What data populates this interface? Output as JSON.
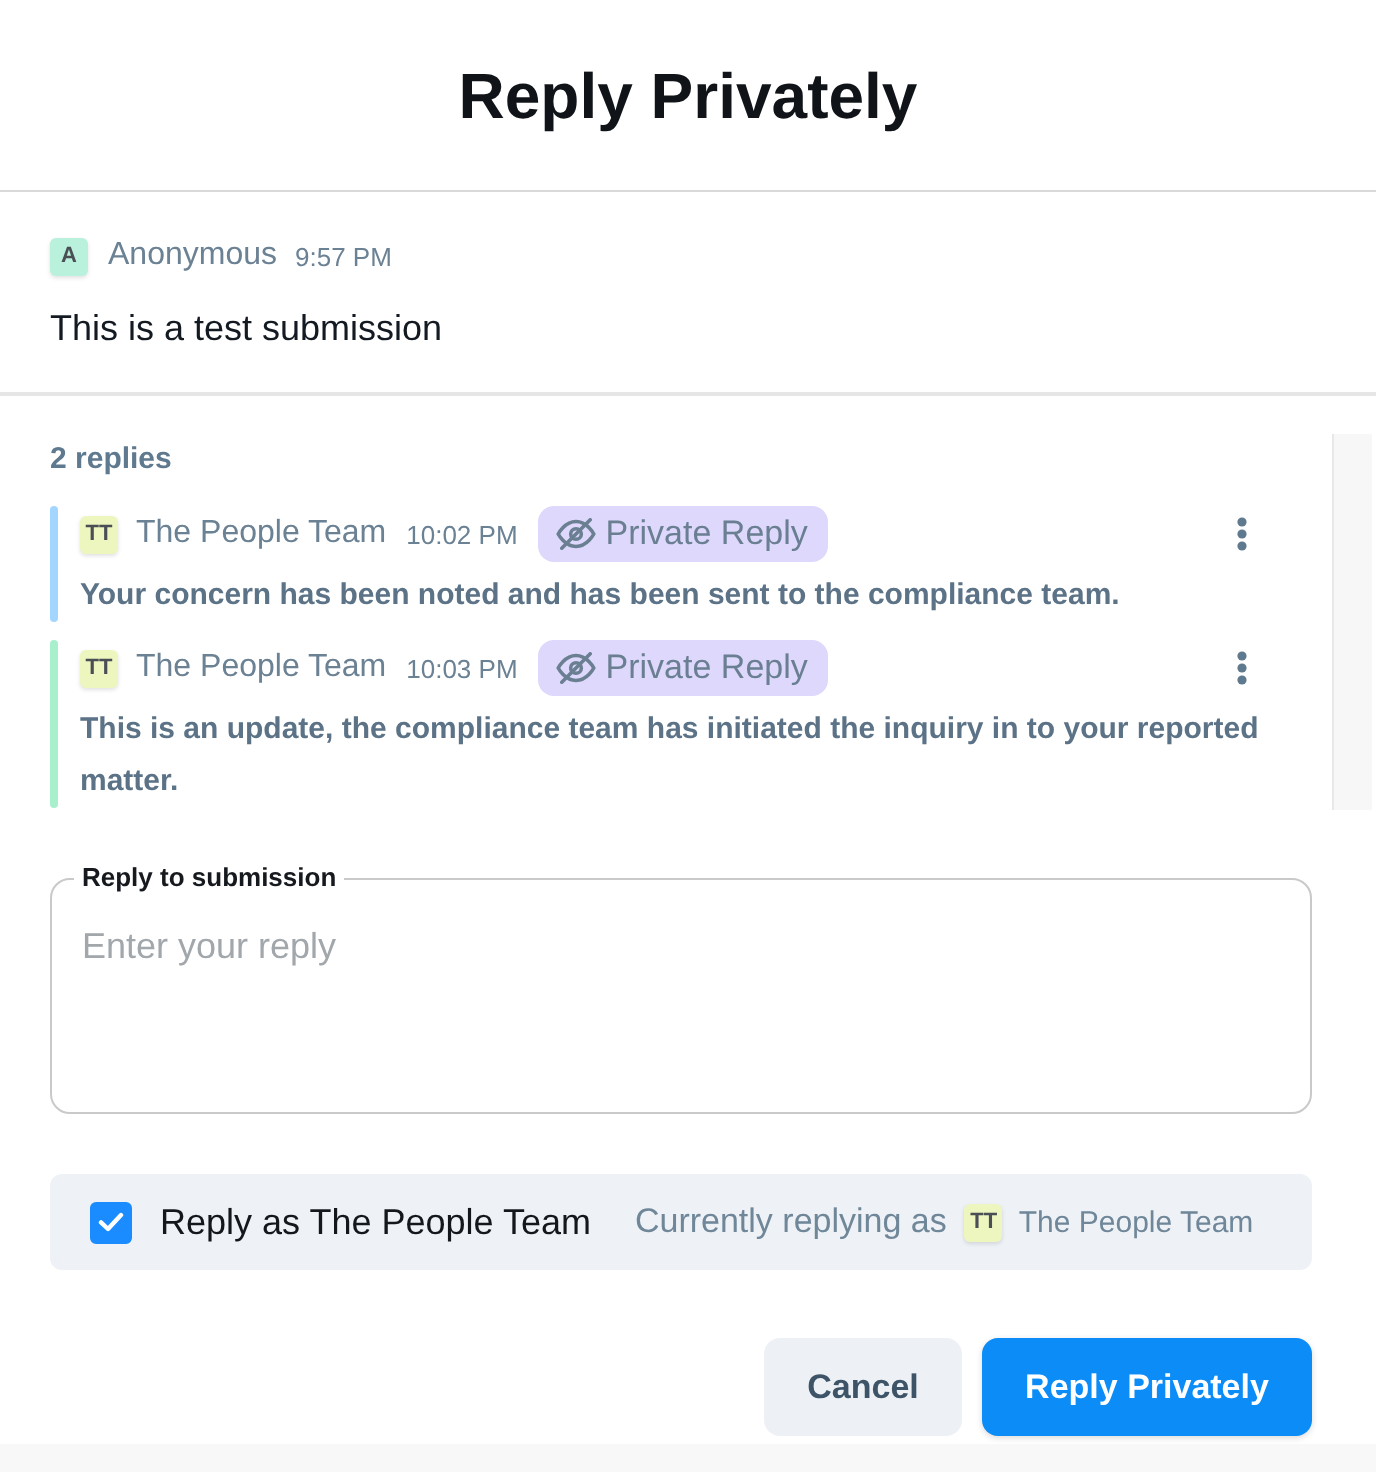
{
  "dialog": {
    "title": "Reply Privately"
  },
  "submission": {
    "avatar": "A",
    "author": "Anonymous",
    "time": "9:57 PM",
    "text": "This is a test submission"
  },
  "replies": {
    "count_label": "2 replies",
    "items": [
      {
        "avatar": "TT",
        "author": "The People Team",
        "time": "10:02 PM",
        "badge": "Private Reply",
        "text": "Your concern has been noted and has been sent to the compliance team.",
        "color": "#a3d6ff"
      },
      {
        "avatar": "TT",
        "author": "The People Team",
        "time": "10:03 PM",
        "badge": "Private Reply",
        "text": "This is an update, the compliance team has initiated the inquiry in to your reported matter.",
        "color": "#a8efcb"
      }
    ]
  },
  "reply_field": {
    "label": "Reply to submission",
    "placeholder": "Enter your reply"
  },
  "reply_as": {
    "checked": true,
    "label": "Reply as The People Team",
    "current_label": "Currently replying as",
    "current_avatar": "TT",
    "current_name": "The People Team"
  },
  "buttons": [
    {
      "label": "Cancel",
      "kind": "secondary"
    },
    {
      "label": "Reply Privately",
      "kind": "primary"
    }
  ]
}
